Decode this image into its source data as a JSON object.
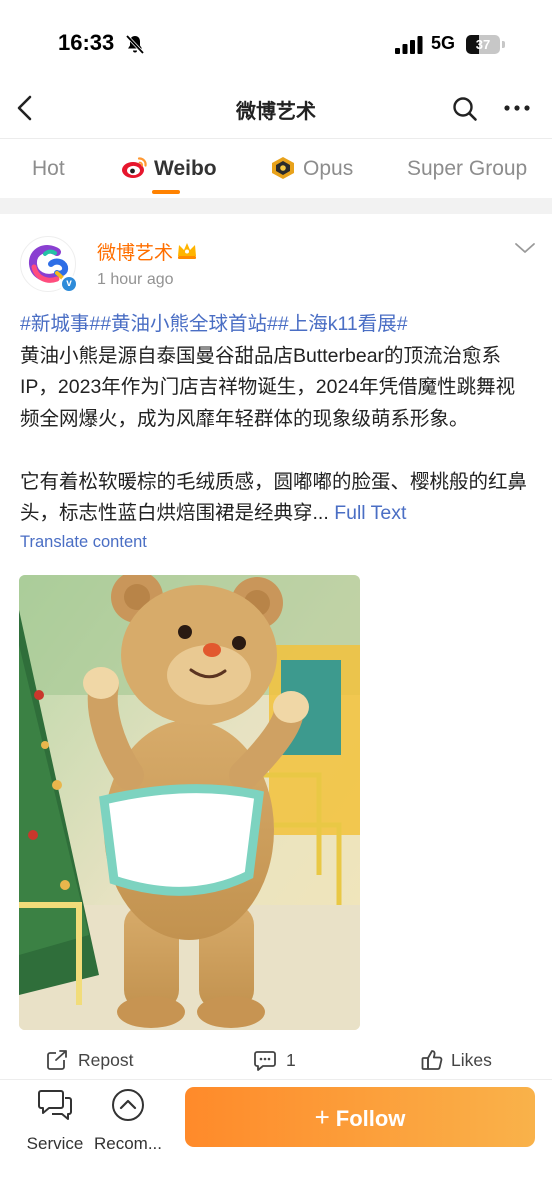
{
  "status_bar": {
    "time": "16:33",
    "network": "5G",
    "battery": 37,
    "battery_label": "37"
  },
  "nav": {
    "title": "微博艺术",
    "icons": [
      "back-icon",
      "search-icon",
      "more-icon"
    ]
  },
  "tabs": [
    {
      "label": "Hot",
      "active": false
    },
    {
      "label": "Weibo",
      "active": true,
      "icon": "weibo-logo-icon"
    },
    {
      "label": "Opus",
      "active": false,
      "icon": "opus-badge-icon"
    },
    {
      "label": "Super Group",
      "active": false
    }
  ],
  "post": {
    "author": "微博艺术",
    "time": "1 hour ago",
    "hashtags": "#新城事##黄油小熊全球首站##上海k11看展#",
    "paragraph1": "黄油小熊是源自泰国曼谷甜品店Butterbear的顶流治愈系IP，2023年作为门店吉祥物诞生，2024年凭借魔性跳舞视频全网爆火，成为风靡年轻群体的现象级萌系形象。",
    "paragraph2": "它有着松软暖棕的毛绒质感，圆嘟嘟的脸蛋、樱桃般的红鼻头，标志性蓝白烘焙围裙是经典穿...",
    "full_text_link": "Full Text",
    "translate": "Translate content",
    "actions": {
      "repost": "Repost",
      "comments": "1",
      "likes": "Likes"
    }
  },
  "bottom_bar": {
    "service": "Service",
    "recommend": "Recom...",
    "follow": "Follow",
    "follow_plus": "+"
  },
  "colors": {
    "accent": "#ff8200",
    "link": "#4a6ec4",
    "author": "#ff6f00",
    "follow_gradient": [
      "#ff8a2a",
      "#f9b24a"
    ]
  }
}
